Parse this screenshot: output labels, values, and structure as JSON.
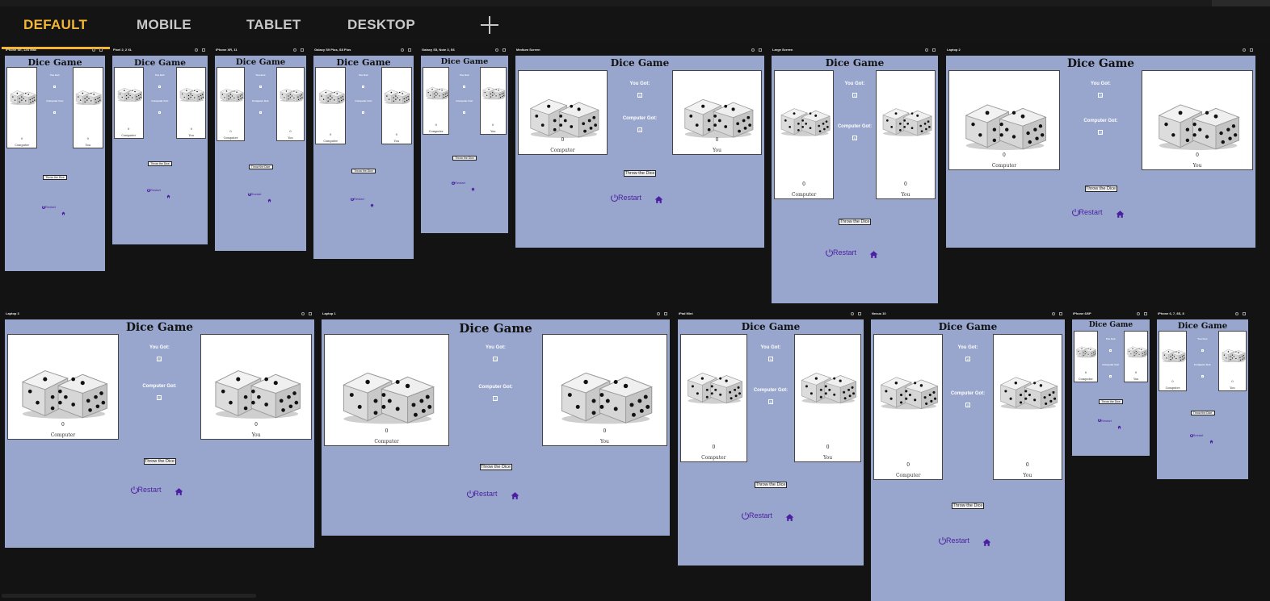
{
  "tabs": [
    {
      "label": "DEFAULT",
      "active": true
    },
    {
      "label": "MOBILE",
      "active": false
    },
    {
      "label": "TABLET",
      "active": false
    },
    {
      "label": "DESKTOP",
      "active": false
    }
  ],
  "add_tab_icon": "plus-icon",
  "game": {
    "title": "Dice Game",
    "you_got_label": "You Got:",
    "computer_got_label": "Computer Got:",
    "you_score": "0",
    "computer_score": "0",
    "computer_card_score": "0",
    "you_card_score": "0",
    "computer_card_label": "Computer",
    "you_card_label": "You",
    "throw_button": "Throw the Dice",
    "restart_button": "Restart",
    "restart_icon": "power-icon",
    "home_icon": "home-icon",
    "dice_icon": "dice-icon"
  },
  "colors": {
    "background": "#131313",
    "accent": "#f5b731",
    "screen": "#98a6cd",
    "link": "#4c1ea1"
  },
  "devices": [
    {
      "name": "iPhone SE, 12S Max",
      "size": "414 × 896"
    },
    {
      "name": "Pixel 2, 2 XL",
      "size": "360 × 798"
    },
    {
      "name": "iPhone XR, 11",
      "size": "375 × 812"
    },
    {
      "name": "Galaxy S9 Plus, S8 Plus",
      "size": "412 × 846"
    },
    {
      "name": "Galaxy S5, Note 3, S6",
      "size": "360 × 740"
    },
    {
      "name": "Medium Screen",
      "size": "1027 × 800"
    },
    {
      "name": "Large Screen",
      "size": "689 × 1027"
    },
    {
      "name": "Laptop 2",
      "size": "1280 × 800"
    },
    {
      "name": "Laptop 3",
      "size": "1280 × 950"
    },
    {
      "name": "Laptop 1",
      "size": "1440 × 900"
    },
    {
      "name": "iPad Mini",
      "size": "768 × 1024"
    },
    {
      "name": "Nexus 10",
      "size": "800 × 1280"
    },
    {
      "name": "iPhone 6/6P",
      "size": "320 × 568"
    },
    {
      "name": "iPhone 6, 7, 8S, 8",
      "size": "375 × 667"
    }
  ]
}
